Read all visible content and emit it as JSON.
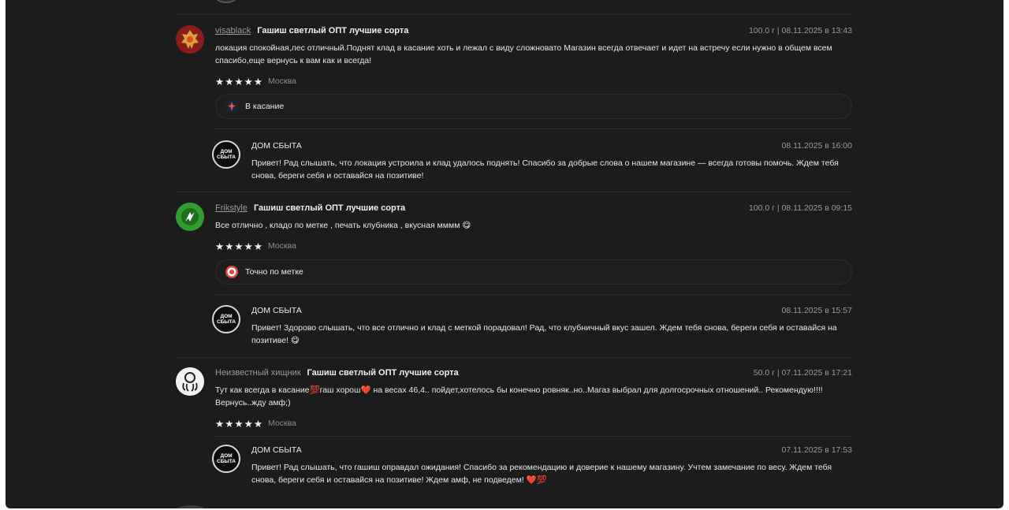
{
  "reviews": [
    {
      "username": "visablack",
      "product": "Гашиш светлый ОПТ лучшие сорта",
      "meta": "100.0 г | 08.11.2025 в 13:43",
      "text": "локация спокойная,лес отличный.Поднят клад в касание хоть и лежал с виду сложновато Магазин всегда отвечает и идет на встречу если нужно в общем всем спасибо,еще вернусь к вам как и всегда!",
      "stars": "★★★★★",
      "city": "Москва",
      "tag": "В касание",
      "reply": {
        "shop": "ДОМ СБЫТА",
        "meta": "08.11.2025 в 16:00",
        "text": "Привет! Рад слышать, что локация устроила и клад удалось поднять! Спасибо за добрые слова о нашем магазине — всегда готовы помочь. Ждем тебя снова, береги себя и оставайся на позитиве!"
      }
    },
    {
      "username": "Frikstyle",
      "product": "Гашиш светлый ОПТ лучшие сорта",
      "meta": "100.0 г | 08.11.2025 в 09:15",
      "text": "Все отлично , кладо по метке , печать клубника , вкусная мммм 😋",
      "stars": "★★★★★",
      "city": "Москва",
      "tag": "Точно по метке",
      "reply": {
        "shop": "ДОМ СБЫТА",
        "meta": "08.11.2025 в 15:57",
        "text": "Привет! Здорово слышать, что все отлично и клад с меткой порадовал! Рад, что клубничный вкус зашел. Ждем тебя снова, береги себя и оставайся на позитиве! 😋"
      }
    },
    {
      "username": "Неизвестный хищник",
      "product": "Гашиш светлый ОПТ лучшие сорта",
      "meta": "50.0 г | 07.11.2025 в 17:21",
      "text": "Тут как всегда в касание💯гаш хорош❤️ на весах 46,4.. пойдет,хотелось бы конечно ровняк..но..Магаз выбрал для долгосрочных отношений.. Рекомендую!!!! Вернусь..жду амф;)",
      "stars": "★★★★★",
      "city": "Москва",
      "reply": {
        "shop": "ДОМ СБЫТА",
        "meta": "07.11.2025 в 17:53",
        "text": "Привет! Рад слышать, что гашиш оправдал ожидания! Спасибо за рекомендацию и доверие к нашему магазину. Учтем замечание по весу. Ждем тебя снова, береги себя и оставайся на позитиве! Ждем амф, не подведем! ❤️💯"
      }
    }
  ],
  "shop_logo": {
    "line1": "ДОМ",
    "line2": "СБЫТА"
  },
  "colors": {
    "background": "#1c1c1c",
    "text": "#e8e8e8",
    "muted": "#9a9a9a"
  }
}
